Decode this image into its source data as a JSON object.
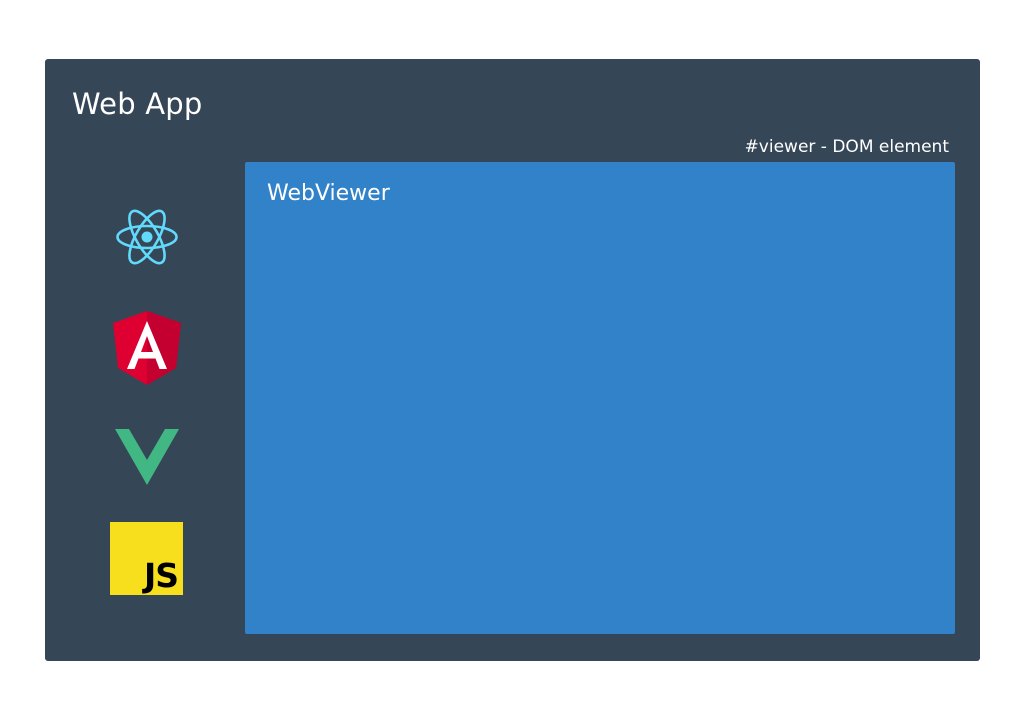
{
  "app": {
    "title": "Web App",
    "background_color": "#354657"
  },
  "viewer": {
    "caption": "#viewer - DOM element",
    "title": "WebViewer",
    "background_color": "#3182c8"
  },
  "frameworks": [
    {
      "icon": "react-icon",
      "color": "#61dafb"
    },
    {
      "icon": "angular-icon",
      "color": "#dd0031"
    },
    {
      "icon": "vue-icon",
      "color": "#41b883"
    },
    {
      "icon": "javascript-icon",
      "label": "JS",
      "color": "#f7df1e"
    }
  ]
}
